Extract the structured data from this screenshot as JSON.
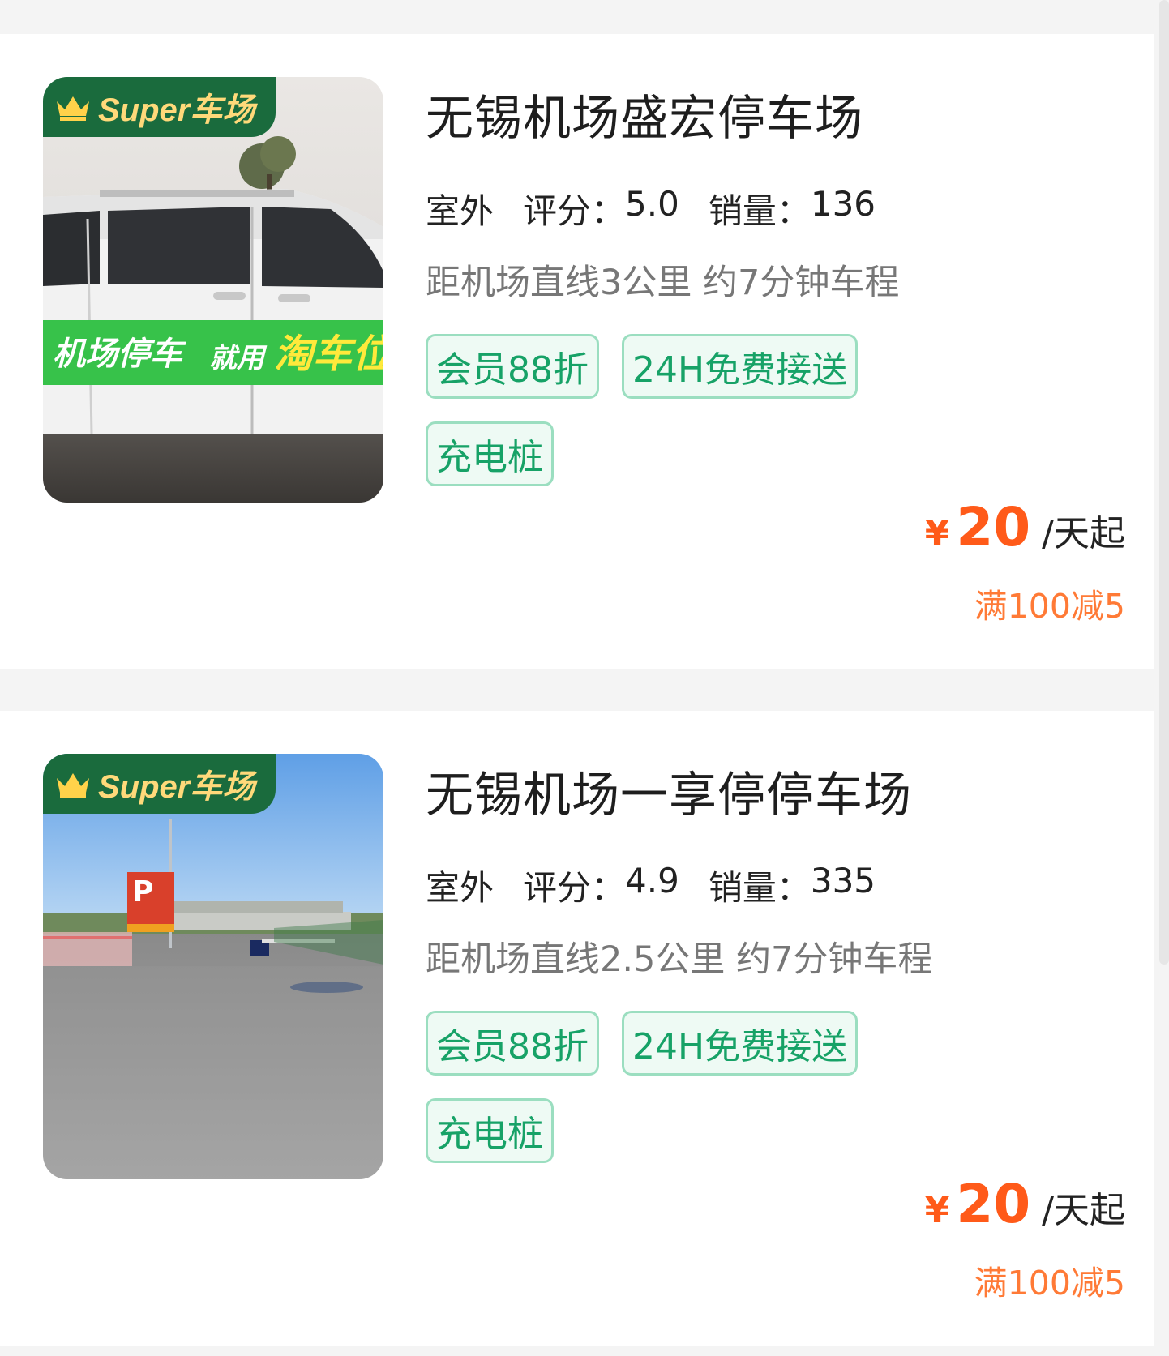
{
  "theme": {
    "accent_orange": "#ff5a19",
    "promo_orange": "#ff7a36",
    "tag_green": "#17a267",
    "badge_green": "#1a6b3d"
  },
  "listings": [
    {
      "badge": "Super车场",
      "image_desc_icon": "car-photo",
      "image_banner": "机场停车 就用淘车位",
      "title": "无锡机场盛宏停车场",
      "type": "室外",
      "rating_label": "评分：",
      "rating": "5.0",
      "sales_label": "销量：",
      "sales": "136",
      "distance": "距机场直线3公里 约7分钟车程",
      "tags": [
        "会员88折",
        "24H免费接送",
        "充电桩"
      ],
      "currency": "¥",
      "price": "20",
      "price_unit": "/天起",
      "promo": "满100减5"
    },
    {
      "badge": "Super车场",
      "image_desc_icon": "parking-lot-photo",
      "image_sign": "P",
      "title": "无锡机场一享停停车场",
      "type": "室外",
      "rating_label": "评分：",
      "rating": "4.9",
      "sales_label": "销量：",
      "sales": "335",
      "distance": "距机场直线2.5公里 约7分钟车程",
      "tags": [
        "会员88折",
        "24H免费接送",
        "充电桩"
      ],
      "currency": "¥",
      "price": "20",
      "price_unit": "/天起",
      "promo": "满100减5"
    }
  ]
}
